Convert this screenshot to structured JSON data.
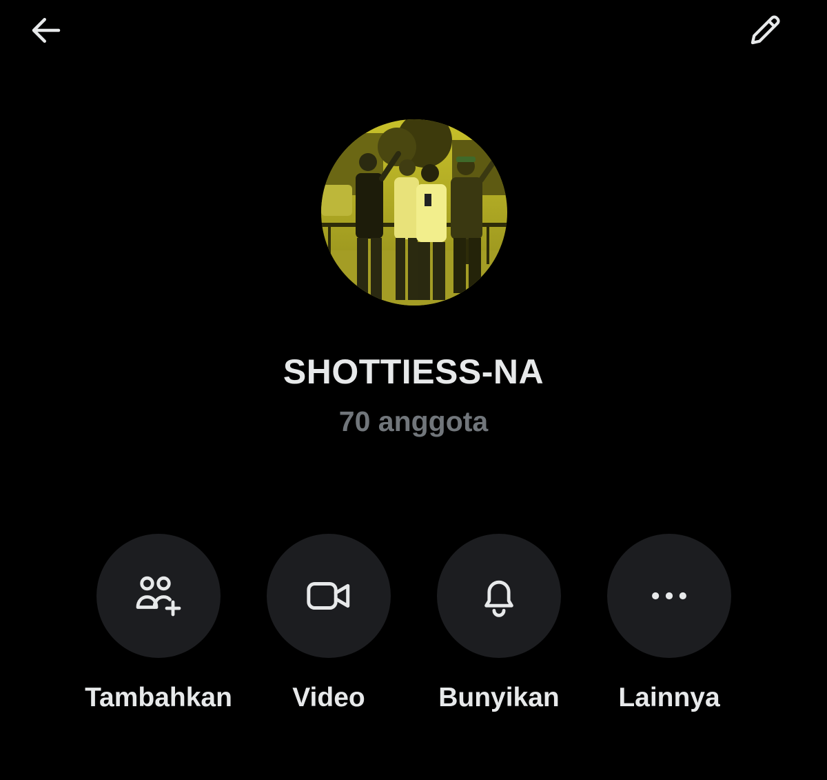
{
  "header": {
    "back_icon": "arrow-left-icon",
    "edit_icon": "pencil-icon"
  },
  "group": {
    "name": "SHOTTIESS-NA",
    "members": "70 anggota",
    "avatar_tint": "#d8cf2a"
  },
  "actions": [
    {
      "label": "Tambahkan",
      "icon": "add-people-icon"
    },
    {
      "label": "Video",
      "icon": "video-camera-icon"
    },
    {
      "label": "Bunyikan",
      "icon": "bell-icon"
    },
    {
      "label": "Lainnya",
      "icon": "more-dots-icon"
    }
  ],
  "colors": {
    "background": "#000000",
    "primary_text": "#e7e9ea",
    "secondary_text": "#71767b",
    "button_bg": "#1c1d20"
  }
}
